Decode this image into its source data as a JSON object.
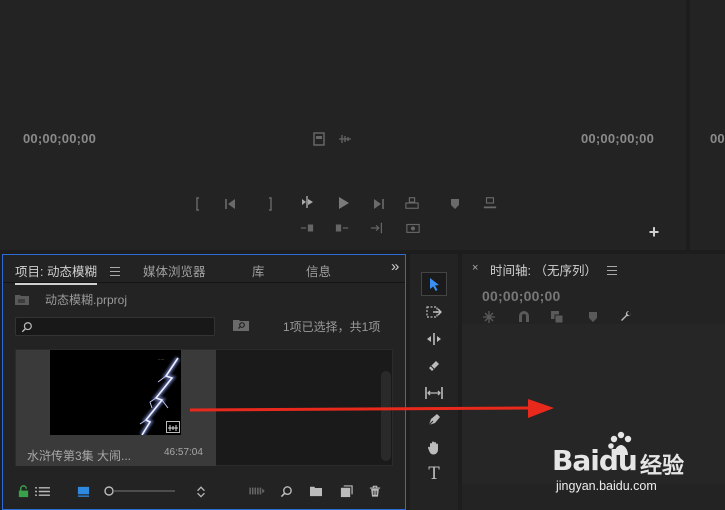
{
  "source_monitor": {
    "timecode_in": "00;00;00;00",
    "timecode_out": "00;00;00;00",
    "add_label": "+"
  },
  "project_panel": {
    "tab_project": "项目: 动态模糊",
    "tab_media_browser": "媒体浏览器",
    "tab_library": "库",
    "tab_info": "信息",
    "overflow": "»",
    "file_name": "动态模糊.prproj",
    "selection_status": "1项已选择，共1项",
    "search_value": "",
    "clip": {
      "name": "水浒传第3集 大闹...",
      "duration": "46:57:04"
    }
  },
  "timeline_panel": {
    "close": "×",
    "title": "时间轴: （无序列）",
    "timecode": "00;00;00;00"
  },
  "tools": [
    "selection-tool",
    "track-select-tool",
    "ripple-edit-tool",
    "razor-tool",
    "slip-tool",
    "pen-tool",
    "hand-tool",
    "type-tool"
  ],
  "watermark": {
    "brand": "Baidu",
    "brand_cn": "经验",
    "url": "jingyan.baidu.com"
  },
  "colors": {
    "panel_bg": "#232323",
    "accent_blue": "#2d6bd6",
    "arrow_red": "#e8291c",
    "lock_green": "#3aa14b"
  }
}
